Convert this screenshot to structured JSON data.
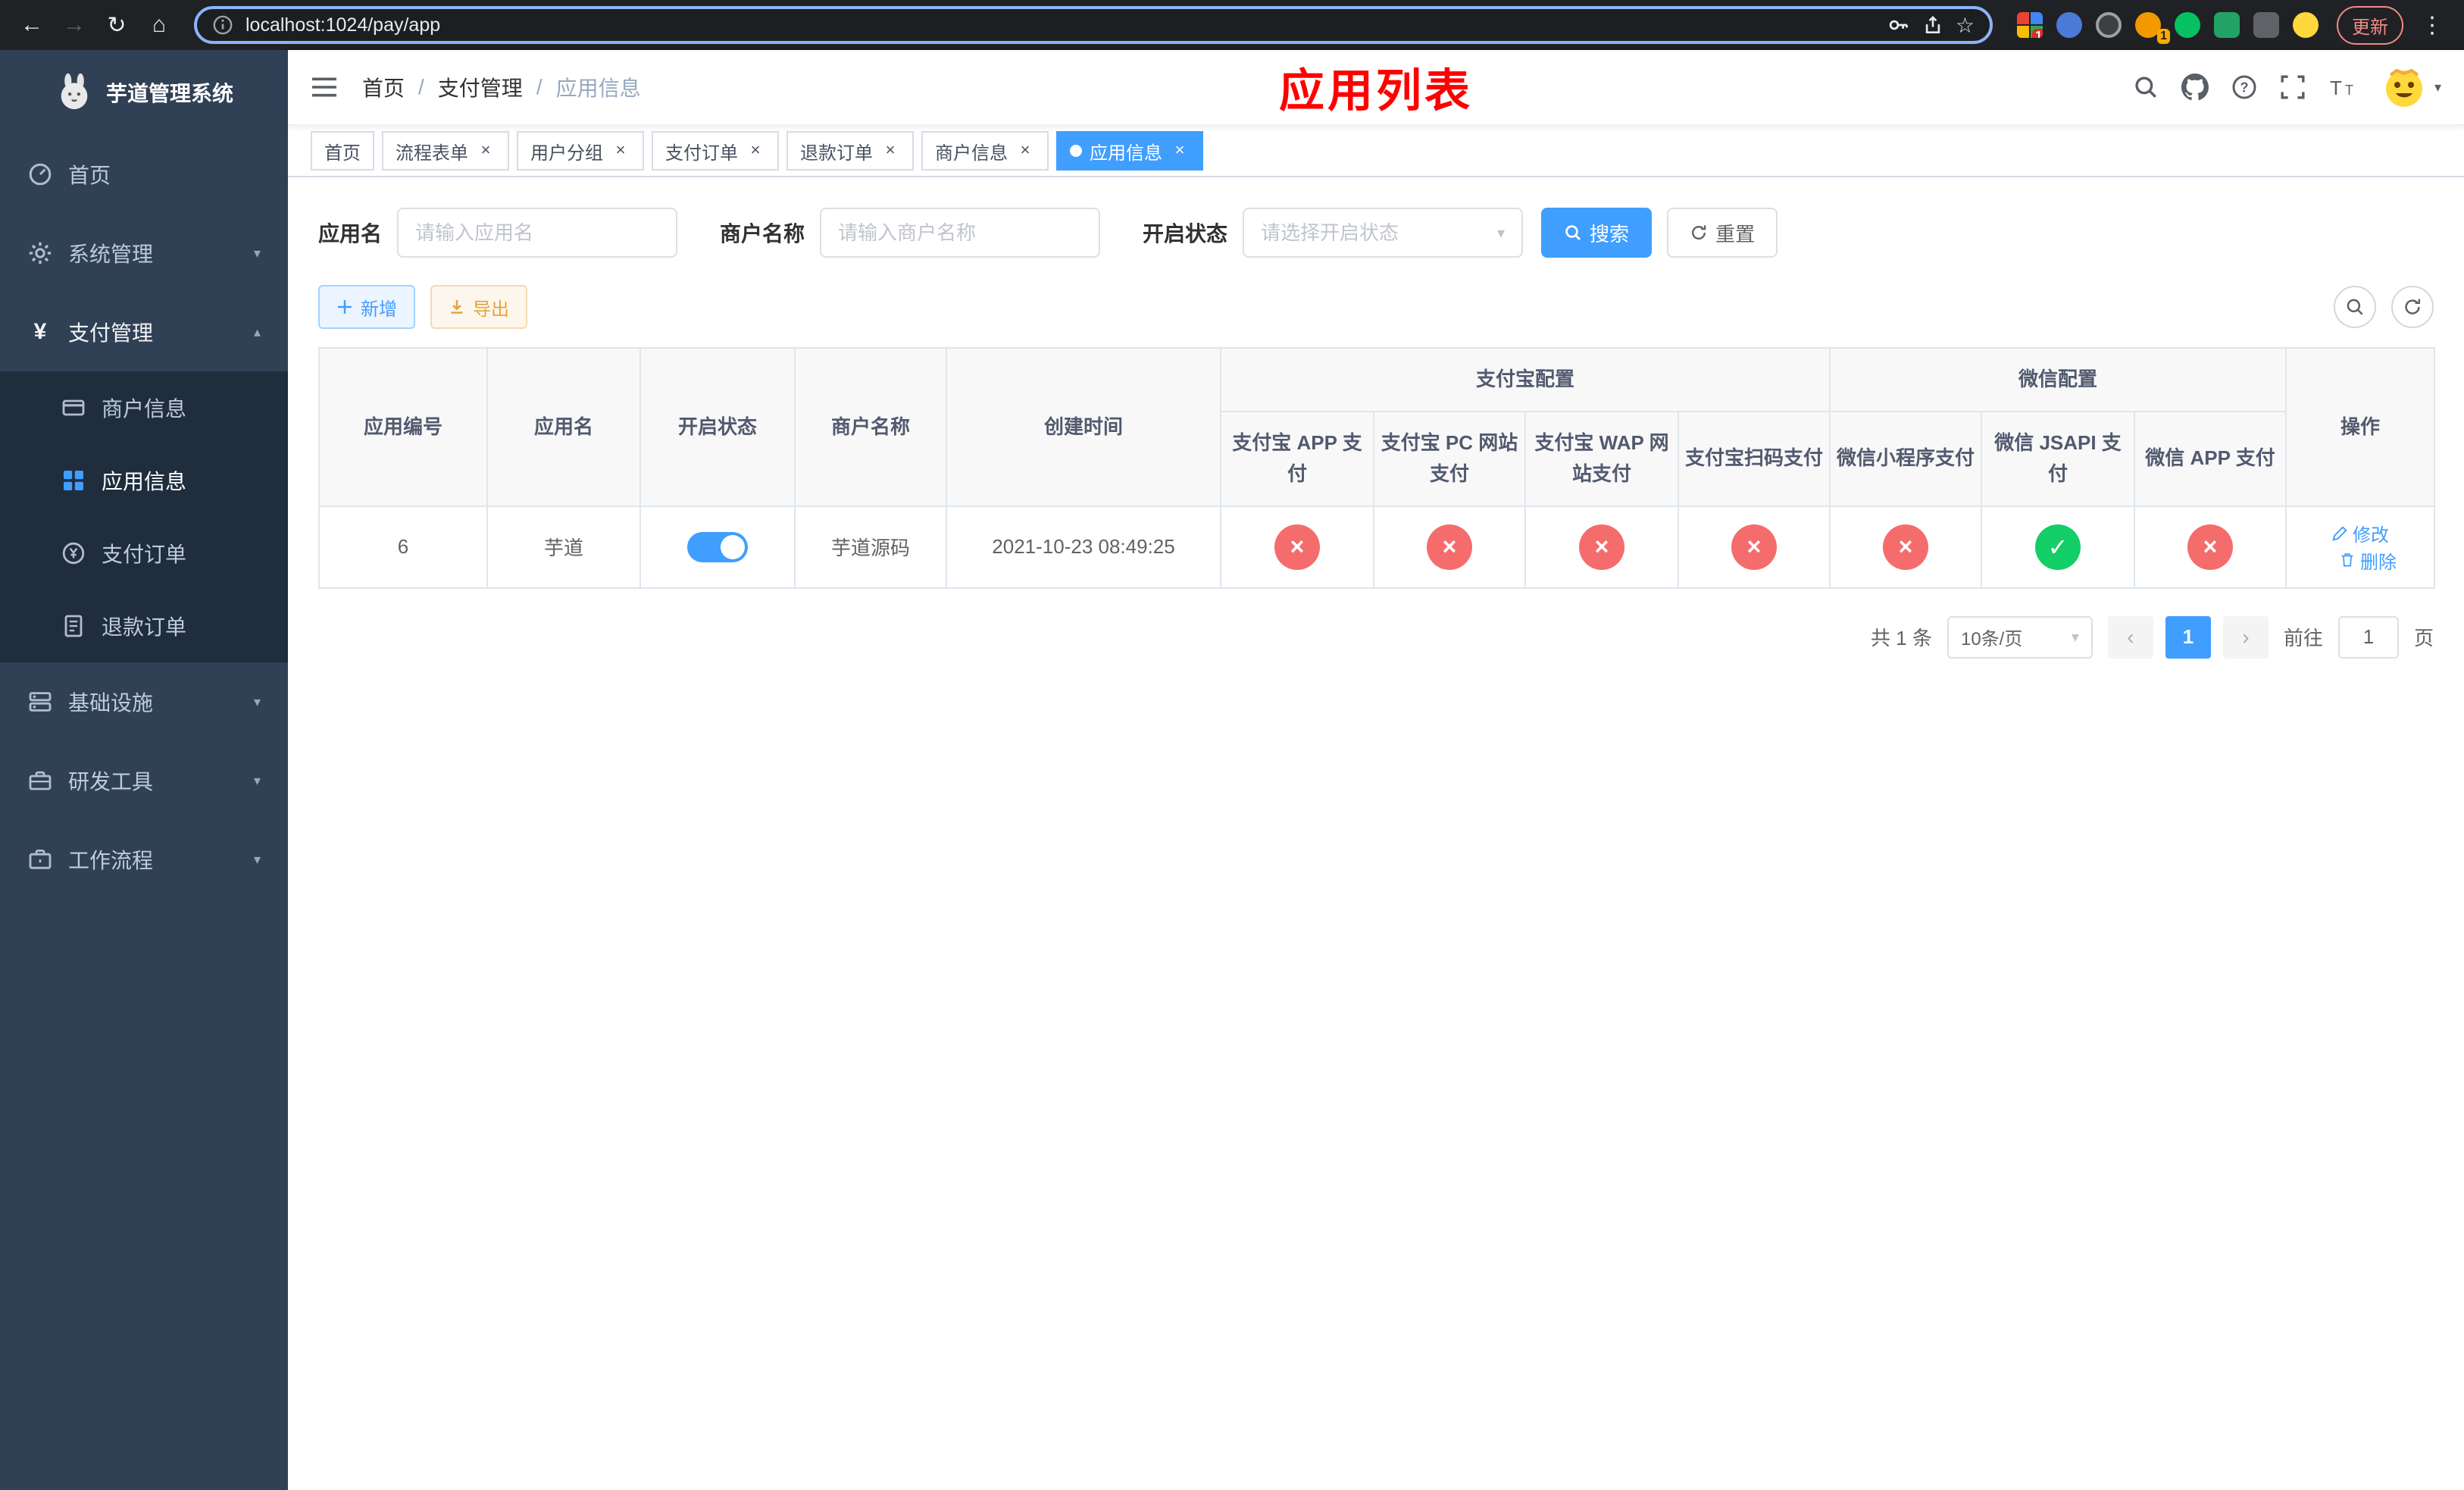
{
  "glyphs": {
    "back": "←",
    "forward": "→",
    "reload": "↻",
    "home": "⌂",
    "dots": "⋮",
    "star": "☆",
    "sep": "/",
    "caret_down": "▾",
    "caret_up": "▴",
    "close": "×",
    "yen": "¥",
    "check": "✓",
    "cross": "×",
    "chevron_left": "‹",
    "chevron_right": "›"
  },
  "browser": {
    "url": "localhost:1024/pay/app",
    "update_button": "更新",
    "ext_badge_1": "10",
    "ext_badge_2": "1"
  },
  "sidebar": {
    "logo_title": "芋道管理系统",
    "menu": [
      {
        "label": "首页"
      },
      {
        "label": "系统管理"
      },
      {
        "label": "支付管理"
      },
      {
        "label": "商户信息"
      },
      {
        "label": "应用信息"
      },
      {
        "label": "支付订单"
      },
      {
        "label": "退款订单"
      },
      {
        "label": "基础设施"
      },
      {
        "label": "研发工具"
      },
      {
        "label": "工作流程"
      }
    ]
  },
  "header": {
    "breadcrumb": [
      "首页",
      "支付管理",
      "应用信息"
    ],
    "annotation": "应用列表",
    "annotation_color": "#ff0000"
  },
  "tabs": [
    {
      "label": "首页"
    },
    {
      "label": "流程表单"
    },
    {
      "label": "用户分组"
    },
    {
      "label": "支付订单"
    },
    {
      "label": "退款订单"
    },
    {
      "label": "商户信息"
    },
    {
      "label": "应用信息"
    }
  ],
  "filters": {
    "app_name_label": "应用名",
    "app_name_placeholder": "请输入应用名",
    "merchant_name_label": "商户名称",
    "merchant_name_placeholder": "请输入商户名称",
    "status_label": "开启状态",
    "status_placeholder": "请选择开启状态",
    "search_button": "搜索",
    "reset_button": "重置"
  },
  "toolbar": {
    "add_button": "新增",
    "export_button": "导出"
  },
  "table": {
    "headers": {
      "app_id": "应用编号",
      "app_name": "应用名",
      "status": "开启状态",
      "merchant_name": "商户名称",
      "created_at": "创建时间",
      "alipay_group": "支付宝配置",
      "wechat_group": "微信配置",
      "alipay_app": "支付宝 APP 支付",
      "alipay_pc": "支付宝 PC 网站支付",
      "alipay_wap": "支付宝 WAP 网站支付",
      "alipay_qr": "支付宝扫码支付",
      "wechat_mini": "微信小程序支付",
      "wechat_jsapi": "微信 JSAPI 支付",
      "wechat_app": "微信 APP 支付",
      "ops": "操作"
    },
    "row": {
      "app_id": "6",
      "app_name": "芋道",
      "status_enabled": true,
      "merchant_name": "芋道源码",
      "created_at": "2021-10-23 08:49:25",
      "alipay_app": "disabled",
      "alipay_pc": "disabled",
      "alipay_wap": "disabled",
      "alipay_qr": "disabled",
      "wechat_mini": "disabled",
      "wechat_jsapi": "enabled",
      "wechat_app": "disabled",
      "edit_link": "修改",
      "delete_link": "删除"
    }
  },
  "pagination": {
    "total": "共 1 条",
    "page_size": "10条/页",
    "page": "1",
    "goto_label": "前往",
    "goto_value": "1",
    "page_unit": "页"
  },
  "colors": {
    "accent": "#409eff",
    "success": "#13ce66",
    "danger": "#f56c6c",
    "warning": "#e6a23c",
    "sidebar_bg": "#304156",
    "submenu_bg": "#1f2d3d"
  }
}
